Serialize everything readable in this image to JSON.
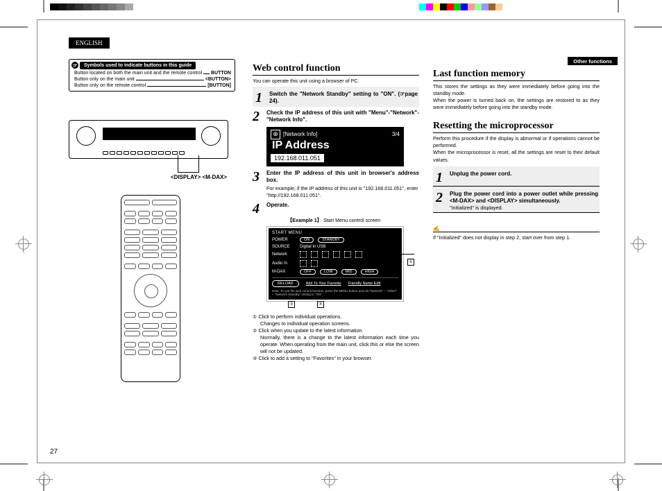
{
  "lang": "ENGLISH",
  "other_fn": "Other functions",
  "symbolsbox": {
    "title": "Symbols used to indicate buttons in this guide",
    "rows": [
      {
        "l": "Button located on both the main unit and the remote control",
        "r": "BUTTON"
      },
      {
        "l": "Button only on the main unit",
        "r": "<BUTTON>"
      },
      {
        "l": "Button only on the remote control",
        "r": "[BUTTON]"
      }
    ]
  },
  "dev_label": "<DISPLAY> <M-DAX>",
  "web": {
    "h": "Web control function",
    "intro": "You can operate this unit using a browser of PC.",
    "s1": "Switch the \"Network Standby\" setting to \"ON\". (☞page 24).",
    "s2": "Check the IP address of this unit with \"Menu\"-\"Network\"-\"Network Info\".",
    "ip_hdr": "[Network Info]",
    "ip_page": "3/4",
    "ip_lbl": "IP Address",
    "ip_val": "192.168.011.051",
    "s3": "Enter the IP address of this unit in browser's address box.",
    "s3b": "For example, if the IP address of this unit is \"192.168.011.051\", enter \"http://192.168.011.051\".",
    "s4": "Operate.",
    "ex_b": "【Example 1】",
    "ex_t": "Start Menu control screen",
    "menu": {
      "hdr": "START MENU",
      "power": "POWER",
      "on": "ON",
      "standby": "STANDBY",
      "source": "SOURCE",
      "src_val": "Digital In USB",
      "network": "Network",
      "audio": "Audio In",
      "mdax": "M-DAX",
      "off": "OFF",
      "low": "LOW",
      "mid": "MID",
      "high": "HIGH",
      "reload": "RELOAD",
      "fav": "Add To Your Favorite",
      "fname": "Friendly Name Edit",
      "note_l": "Note",
      "note": "To use the web control function, press the MENU button and set \"Network\" – \"Other\" – \"Network Standby\" setting to \"ON\"."
    },
    "notes": {
      "n1a": "① Click to perform individual operations.",
      "n1b": "Changes to individual operation screens.",
      "n2a": "② Click when you update to the latest information.",
      "n2b": "Normally, there is a change to the latest information each time you operate. When operating from the main unit, click this or else the screen will not be updated.",
      "n3": "③ Click to add a setting to \"Favorites\" in your browser."
    }
  },
  "last": {
    "h": "Last function memory",
    "p1": "This stores the settings as they were immediately before going into the standby mode.",
    "p2": "When the power is turned back on, the settings are restored to as they were immediately before going into the standby mode."
  },
  "reset": {
    "h": "Resetting the microprocessor",
    "p1": "Perform this procedure if the display is abnormal or if operations cannot be performed.",
    "p2": "When the microprocessor is reset, all the settings are reset to their default values.",
    "s1": "Unplug the power cord.",
    "s2": "Plug the power cord into a power outlet while pressing <M-DAX> and <DISPLAY> simultaneously.",
    "s2b": "\"Initialized\" is displayed.",
    "note": "If \"Initialized\" does not display in step 2, start over from step 1."
  },
  "page": "27"
}
